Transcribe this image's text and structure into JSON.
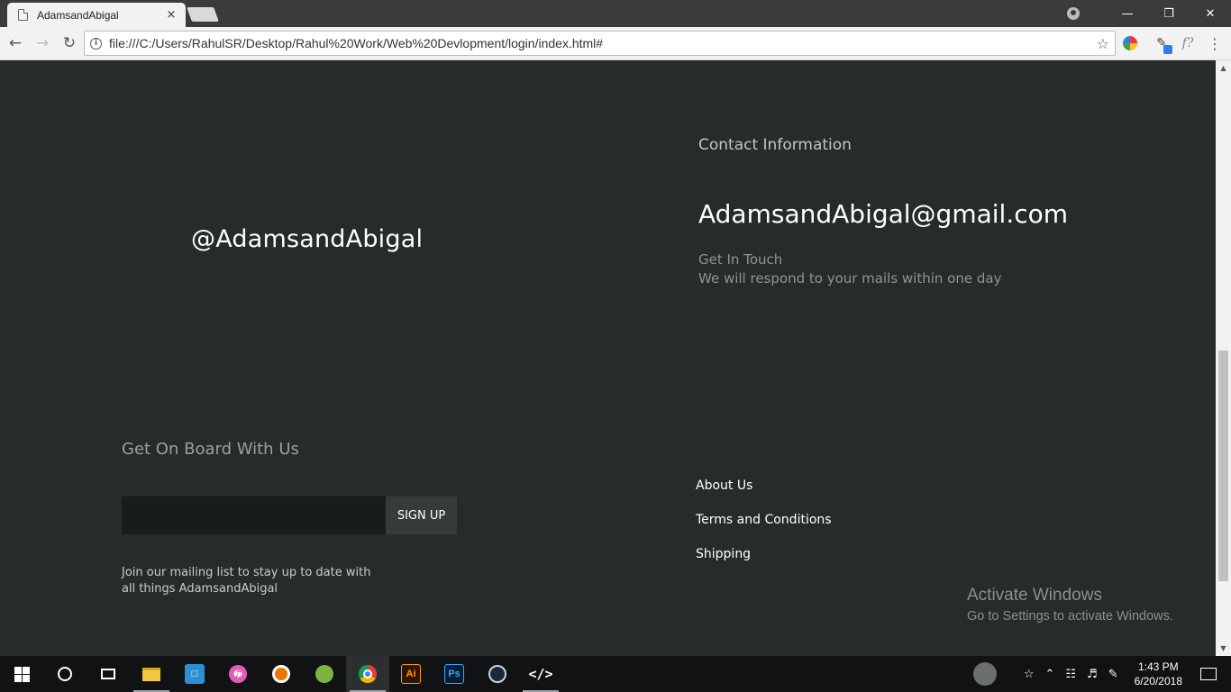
{
  "browser": {
    "tab_title": "AdamsandAbigal",
    "tab_close": "×",
    "url": "file:///C:/Users/RahulSR/Desktop/Rahul%20Work/Web%20Devlopment/login/index.html#",
    "window_controls": {
      "minimize": "—",
      "restore": "❐",
      "close": "✕"
    }
  },
  "page": {
    "handle": "@AdamsandAbigal",
    "contact": {
      "heading": "Contact Information",
      "email": "AdamsandAbigal@gmail.com",
      "touch_title": "Get In Touch",
      "touch_sub": "We will respond to your mails within one day"
    },
    "newsletter": {
      "heading": "Get On Board With Us",
      "input_value": "",
      "button_label": "SIGN UP",
      "description": "Join our mailing list to stay up to date with all things AdamsandAbigal"
    },
    "footer_links": [
      "About Us",
      "Terms and Conditions",
      "Shipping"
    ]
  },
  "watermark": {
    "line1": "Activate Windows",
    "line2": "Go to Settings to activate Windows."
  },
  "taskbar": {
    "apps": [
      "windows-start",
      "cortana",
      "task-view",
      "file-explorer",
      "app-square",
      "itunes",
      "blender",
      "android-studio",
      "chrome",
      "illustrator",
      "photoshop",
      "steam",
      "code-editor"
    ],
    "illustrator_label": "Ai",
    "photoshop_label": "Ps",
    "clock_time": "1:43 PM",
    "clock_date": "6/20/2018"
  },
  "colors": {
    "page_background": "#262b2c",
    "accent_white": "#ffffff",
    "muted_text": "#8f9597"
  }
}
